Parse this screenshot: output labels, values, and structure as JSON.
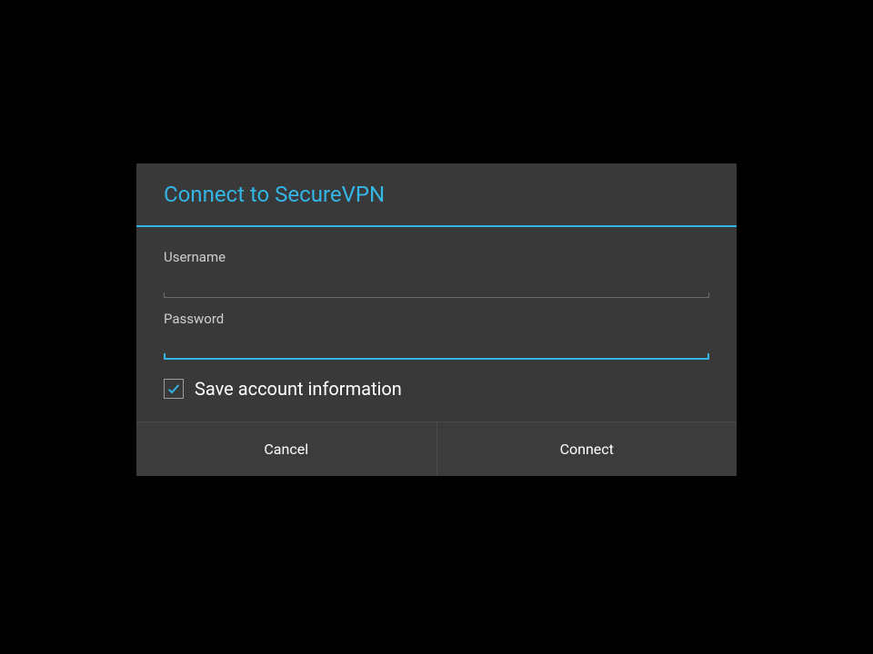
{
  "dialog": {
    "title": "Connect to SecureVPN",
    "username": {
      "label": "Username",
      "value": "",
      "placeholder": ""
    },
    "password": {
      "label": "Password",
      "value": "",
      "placeholder": ""
    },
    "save_checkbox": {
      "label": "Save account information",
      "checked": true
    },
    "buttons": {
      "cancel": "Cancel",
      "connect": "Connect"
    }
  },
  "colors": {
    "accent": "#33b5e5",
    "dialog_bg": "#393939",
    "text_light": "#ffffff",
    "text_muted": "#cfcfcf"
  }
}
